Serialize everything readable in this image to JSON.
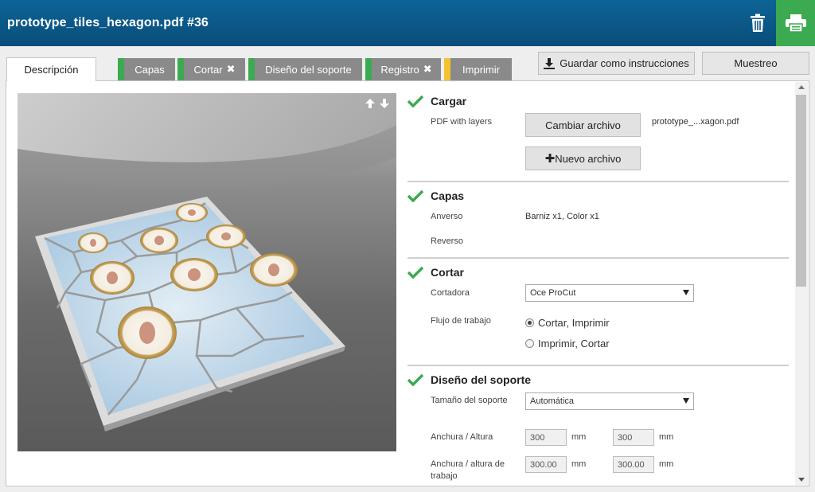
{
  "header": {
    "title": "prototype_tiles_hexagon.pdf #36"
  },
  "tabs": [
    {
      "label": "Descripción",
      "active": true,
      "status_color": ""
    },
    {
      "label": "Capas",
      "active": false,
      "status_color": "#3caa50",
      "error": false
    },
    {
      "label": "Cortar",
      "active": false,
      "status_color": "#3caa50",
      "error": true
    },
    {
      "label": "Diseño del soporte",
      "active": false,
      "status_color": "#3caa50",
      "error": false
    },
    {
      "label": "Registro",
      "active": false,
      "status_color": "#3caa50",
      "error": true
    },
    {
      "label": "Imprimir",
      "active": false,
      "status_color": "#f2c230",
      "error": false
    }
  ],
  "toolbar": {
    "save_label": "Guardar como instrucciones",
    "sample_label": "Muestreo"
  },
  "sections": {
    "cargar": {
      "title": "Cargar",
      "label": "PDF with layers",
      "change_file_label": "Cambiar archivo",
      "new_file_label": "Nuevo archivo",
      "file_name": "prototype_...xagon.pdf"
    },
    "capas": {
      "title": "Capas",
      "front_label": "Anverso",
      "front_value": "Barniz x1, Color x1",
      "back_label": "Reverso"
    },
    "cortar": {
      "title": "Cortar",
      "cutter_label": "Cortadora",
      "cutter_value": "Oce ProCut",
      "workflow_label": "Flujo de trabajo",
      "workflow_options": [
        "Cortar, Imprimir",
        "Imprimir, Cortar"
      ],
      "workflow_selected": 0
    },
    "soporte": {
      "title": "Diseño del soporte",
      "size_label": "Tamaño del soporte",
      "size_value": "Automática",
      "width_height_label": "Anchura / Altura",
      "width_value": "300",
      "height_value": "300",
      "work_label": "Anchura / altura de trabajo",
      "work_width_value": "300.00",
      "work_height_value": "300.00",
      "unit": "mm"
    }
  },
  "colors": {
    "header": "#0a5a8c",
    "print_button": "#3caa50",
    "check": "#3caa50",
    "tab_ok": "#3caa50",
    "tab_warning": "#f2c230"
  }
}
